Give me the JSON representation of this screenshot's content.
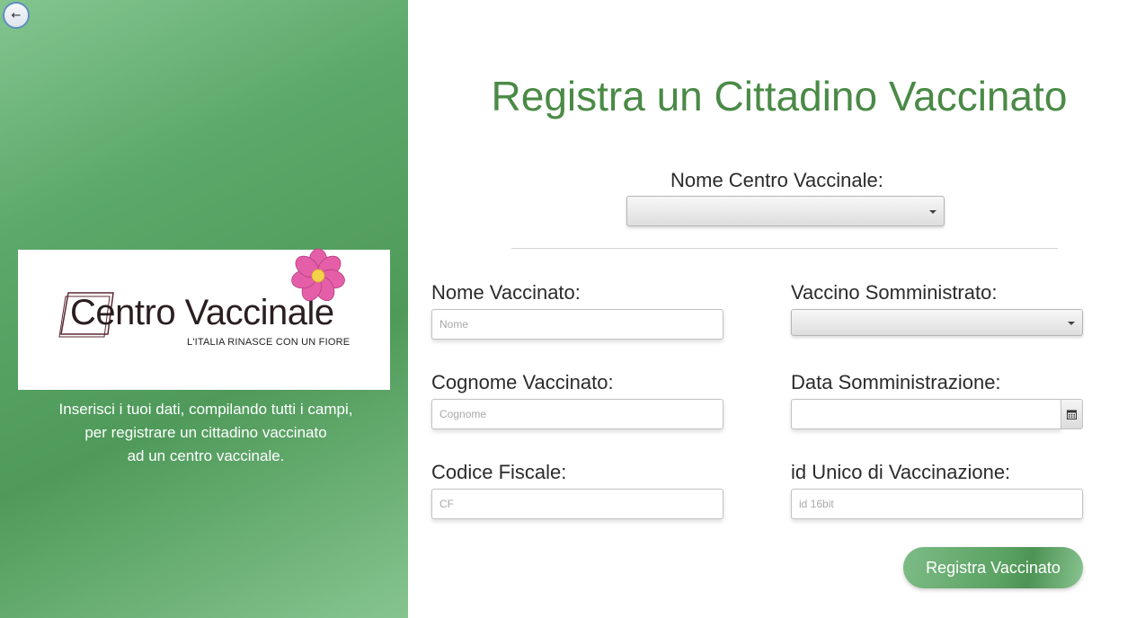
{
  "nav": {
    "back_label": "←"
  },
  "logo": {
    "title_first": "C",
    "title_rest": "entro Vaccinale",
    "tagline": "L'ITALIA RINASCE CON UN FIORE"
  },
  "sidebar": {
    "description_lines": [
      "Inserisci i tuoi dati, compilando tutti i campi,",
      "per registrare un cittadino vaccinato",
      "ad un centro vaccinale."
    ]
  },
  "form": {
    "title": "Registra un Cittadino Vaccinato",
    "centro_label": "Nome Centro Vaccinale:",
    "centro_value": "",
    "nome_label": "Nome Vaccinato:",
    "nome_placeholder": "Nome",
    "nome_value": "",
    "cognome_label": "Cognome Vaccinato:",
    "cognome_placeholder": "Cognome",
    "cognome_value": "",
    "cf_label": "Codice Fiscale:",
    "cf_placeholder": "CF",
    "cf_value": "",
    "vaccino_label": "Vaccino Somministrato:",
    "vaccino_value": "",
    "data_label": "Data Somministrazione:",
    "data_value": "",
    "id_label": "id Unico di Vaccinazione:",
    "id_placeholder": "id 16bit",
    "id_value": "",
    "submit_label": "Registra Vaccinato"
  },
  "colors": {
    "accent_green": "#4a8a46",
    "panel_green": "#5ba86a",
    "flower_pink": "#e45fa8",
    "flower_center": "#f3d34a"
  }
}
